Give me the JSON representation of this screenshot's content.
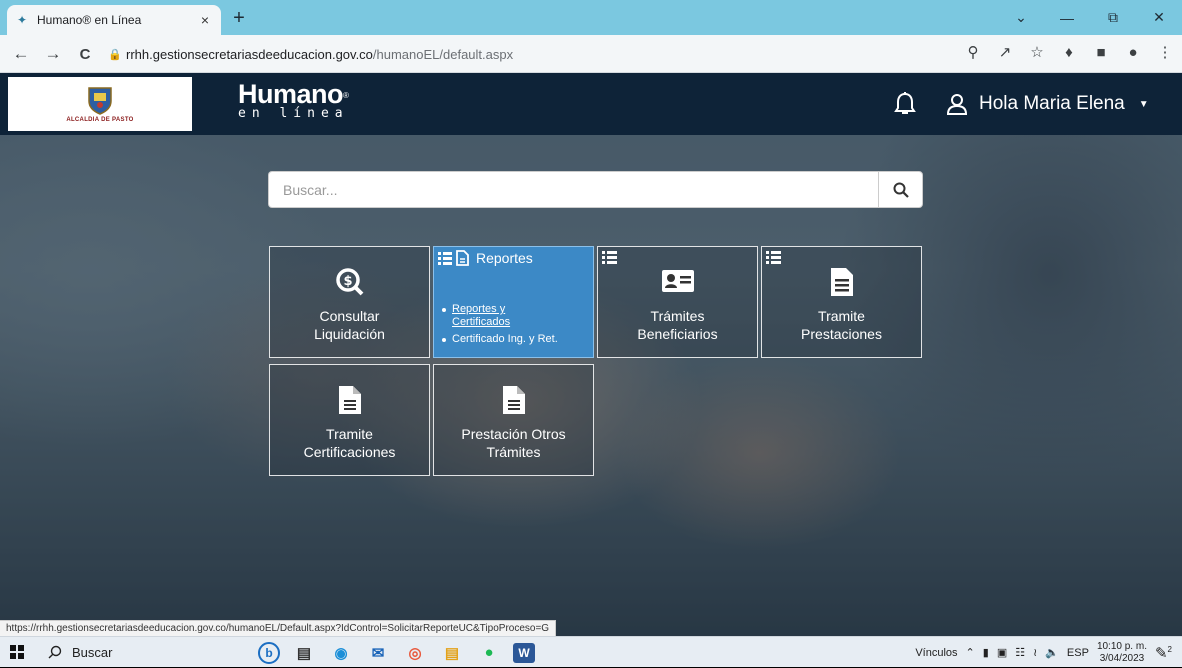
{
  "browser": {
    "tab_title": "Humano® en Línea",
    "tab_close": "×",
    "new_tab": "+",
    "url_host": "rrhh.gestionsecretariasdeeducacion.gov.co",
    "url_path": "/humanoEL/default.aspx",
    "window_controls": [
      "⌄",
      "—",
      "⧉",
      "✕"
    ],
    "nav": [
      "←",
      "→",
      "C"
    ]
  },
  "header": {
    "logo_text": "ALCALDIA DE PASTO",
    "brand_main": "Humano",
    "brand_reg": "®",
    "brand_sub": "en línea",
    "greeting": "Hola Maria Elena"
  },
  "search": {
    "placeholder": "Buscar..."
  },
  "tiles": [
    {
      "line1": "Consultar",
      "line2": "Liquidación",
      "icon": "search-money-icon"
    },
    {
      "title": "Reportes",
      "icon": "list-document-icon",
      "links": [
        "Reportes y",
        "Certificados",
        "Certificado Ing. y Ret."
      ]
    },
    {
      "line1": "Trámites",
      "line2": "Beneficiarios",
      "icon": "id-card-icon"
    },
    {
      "line1": "Tramite",
      "line2": "Prestaciones",
      "icon": "document-list-icon"
    },
    {
      "line1": "Tramite",
      "line2": "Certificaciones",
      "icon": "document-icon"
    },
    {
      "line1": "Prestación Otros",
      "line2": "Trámites",
      "icon": "document-icon"
    }
  ],
  "status_url": "https://rrhh.gestionsecretariasdeeducacion.gov.co/humanoEL/Default.aspx?IdControl=SolicitarReporteUC&TipoProceso=G",
  "taskbar": {
    "search_label": "Buscar",
    "links_label": "Vínculos",
    "lang": "ESP",
    "time": "10:10 p. m.",
    "date": "3/04/2023",
    "notif_count": "2"
  },
  "colors": {
    "header_bg": "#0e2338",
    "active_tile": "#3c89c6",
    "tab_strip": "#7bc8e0"
  }
}
